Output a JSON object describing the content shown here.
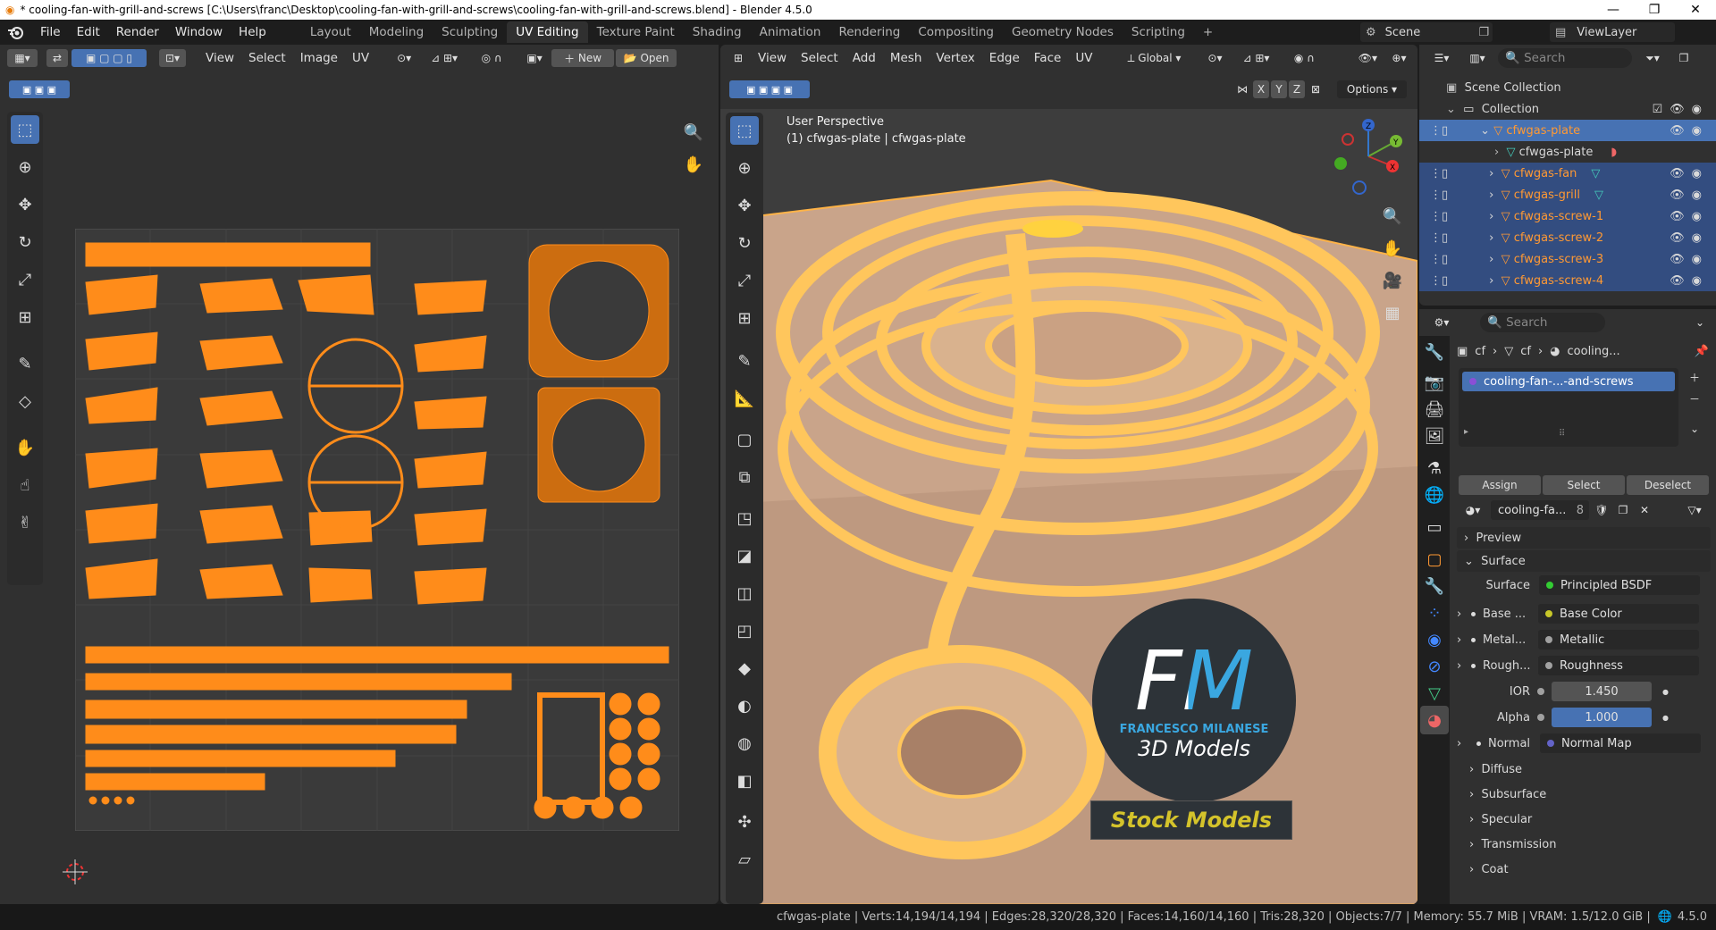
{
  "title": "* cooling-fan-with-grill-and-screws [C:\\Users\\franc\\Desktop\\cooling-fan-with-grill-and-screws\\cooling-fan-with-grill-and-screws.blend] - Blender 4.5.0",
  "menu": [
    "File",
    "Edit",
    "Render",
    "Window",
    "Help"
  ],
  "workspaces": [
    "Layout",
    "Modeling",
    "Sculpting",
    "UV Editing",
    "Texture Paint",
    "Shading",
    "Animation",
    "Rendering",
    "Compositing",
    "Geometry Nodes",
    "Scripting"
  ],
  "active_workspace": "UV Editing",
  "scene": "Scene",
  "view_layer": "ViewLayer",
  "uv_editor": {
    "header": [
      "View",
      "Select",
      "Image",
      "UV"
    ],
    "new_label": "New",
    "open_label": "Open"
  },
  "viewport": {
    "header": [
      "View",
      "Select",
      "Add",
      "Mesh",
      "Vertex",
      "Edge",
      "Face",
      "UV"
    ],
    "transform": "Global",
    "options_label": "Options",
    "axes": [
      "X",
      "Y",
      "Z"
    ],
    "perspective": "User Perspective",
    "object_info": "(1) cfwgas-plate | cfwgas-plate",
    "watermark": {
      "brand_initials": "FM",
      "brand_name": "FRANCESCO MILANESE",
      "tagline": "3D Models",
      "banner": "Stock Models"
    }
  },
  "outliner": {
    "search_placeholder": "Search",
    "scene_collection": "Scene Collection",
    "collection": "Collection",
    "items": [
      {
        "name": "cfwgas-plate",
        "level": 1,
        "state": "active"
      },
      {
        "name": "cfwgas-plate",
        "level": 2,
        "state": "mesh"
      },
      {
        "name": "cfwgas-fan",
        "level": 1,
        "state": "selected"
      },
      {
        "name": "cfwgas-grill",
        "level": 1,
        "state": "selected"
      },
      {
        "name": "cfwgas-screw-1",
        "level": 1,
        "state": "selected"
      },
      {
        "name": "cfwgas-screw-2",
        "level": 1,
        "state": "selected"
      },
      {
        "name": "cfwgas-screw-3",
        "level": 1,
        "state": "selected"
      },
      {
        "name": "cfwgas-screw-4",
        "level": 1,
        "state": "selected"
      }
    ]
  },
  "properties": {
    "search_placeholder": "Search",
    "breadcrumb": [
      "cf",
      "cf",
      "cooling..."
    ],
    "material_slot": "cooling-fan-...-and-screws",
    "assign": "Assign",
    "select": "Select",
    "deselect": "Deselect",
    "material_name": "cooling-fa...",
    "material_users": "8",
    "panels": {
      "preview": "Preview",
      "surface": "Surface",
      "diffuse": "Diffuse",
      "subsurface": "Subsurface",
      "specular": "Specular",
      "transmission": "Transmission",
      "coat": "Coat"
    },
    "surface_label": "Surface",
    "surface_value": "Principled BSDF",
    "inputs": [
      {
        "label": "Base ...",
        "value": "Base Color",
        "dot": "#c7c729"
      },
      {
        "label": "Metal...",
        "value": "Metallic",
        "dot": "#a1a1a1"
      },
      {
        "label": "Rough...",
        "value": "Roughness",
        "dot": "#a1a1a1"
      }
    ],
    "ior_label": "IOR",
    "ior_value": "1.450",
    "alpha_label": "Alpha",
    "alpha_value": "1.000",
    "normal_label": "Normal",
    "normal_value": "Normal Map"
  },
  "status": "cfwgas-plate | Verts:14,194/14,194 | Edges:28,320/28,320 | Faces:14,160/14,160 | Tris:28,320 | Objects:7/7 | Memory: 55.7 MiB | VRAM: 1.5/12.0 GiB |",
  "version": "4.5.0",
  "colors": {
    "accent": "#4772b3",
    "selection_orange": "#ff8c1a",
    "background": "#303030"
  }
}
